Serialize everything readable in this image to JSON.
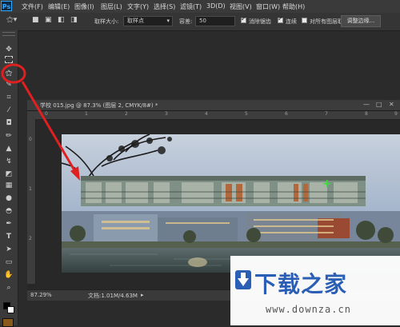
{
  "app": {
    "logo": "Ps"
  },
  "menu": [
    "文件(F)",
    "编辑(E)",
    "图像(I)",
    "图层(L)",
    "文字(Y)",
    "选择(S)",
    "滤镜(T)",
    "3D(D)",
    "视图(V)",
    "窗口(W)",
    "帮助(H)"
  ],
  "options": {
    "sample_size_label": "取样大小:",
    "sample_size_value": "取样点",
    "tolerance_label": "容差:",
    "tolerance_value": "50",
    "antialias_label": "消除锯齿",
    "contiguous_label": "连续",
    "sample_all_label": "对所有图层取样",
    "refine_edge_button": "调整边缘..."
  },
  "tools": [
    "move-tool",
    "marquee-tool",
    "magic-wand-tool",
    "crop-tool",
    "eyedropper-tool",
    "healing-tool",
    "brush-tool",
    "stamp-tool",
    "history-brush-tool",
    "eraser-tool",
    "gradient-tool",
    "blur-tool",
    "dodge-tool",
    "pen-tool",
    "type-tool",
    "path-select-tool",
    "shape-tool",
    "hand-tool",
    "zoom-tool"
  ],
  "document": {
    "tab_title": "学校 015.jpg @ 87.3% (图层 2, CMYK/8#) *",
    "zoom": "87.29%",
    "doc_size": "文档:1.01M/4.63M"
  },
  "ruler": {
    "h": [
      "0",
      "1",
      "2",
      "3",
      "4",
      "5",
      "6",
      "7",
      "8",
      "9"
    ],
    "v": [
      "0",
      "1",
      "2"
    ]
  },
  "watermark": {
    "title": "下载之家",
    "url": "www.downza.cn"
  },
  "colors": {
    "highlight": "#e02020",
    "accent": "#31a8ff"
  }
}
